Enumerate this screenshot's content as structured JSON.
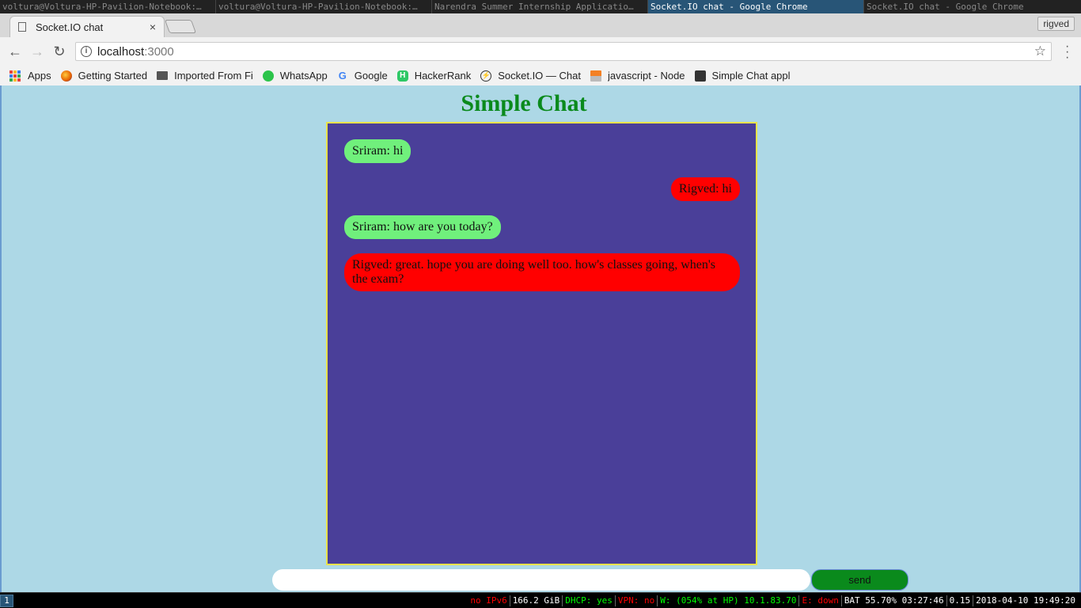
{
  "wm": {
    "windows": [
      {
        "title": "voltura@Voltura-HP-Pavilion-Notebook:…",
        "focused": false
      },
      {
        "title": "voltura@Voltura-HP-Pavilion-Notebook:…",
        "focused": false
      },
      {
        "title": "Narendra Summer Internship Applicatio…",
        "focused": false
      },
      {
        "title": "Socket.IO chat - Google Chrome",
        "focused": true
      },
      {
        "title": "Socket.IO chat - Google Chrome",
        "focused": false
      }
    ],
    "workspace": "1"
  },
  "browser": {
    "tab_title": "Socket.IO chat",
    "tab_close": "×",
    "profile_name": "rigved",
    "address_host": "localhost",
    "address_port": ":3000",
    "bookmarks": [
      {
        "label": "Apps",
        "icon": "apps-grid-icon"
      },
      {
        "label": "Getting Started",
        "icon": "firefox-icon"
      },
      {
        "label": "Imported From Fi",
        "icon": "folder-icon"
      },
      {
        "label": "WhatsApp",
        "icon": "whatsapp-icon"
      },
      {
        "label": "Google",
        "icon": "google-icon"
      },
      {
        "label": "HackerRank",
        "icon": "hackerrank-icon"
      },
      {
        "label": "Socket.IO — Chat",
        "icon": "socketio-icon"
      },
      {
        "label": "javascript - Node",
        "icon": "stackoverflow-icon"
      },
      {
        "label": "Simple Chat appl",
        "icon": "page-icon"
      }
    ]
  },
  "app": {
    "title": "Simple Chat",
    "messages": [
      {
        "text": "Sriram: hi",
        "side": "left"
      },
      {
        "text": "Rigved: hi",
        "side": "right"
      },
      {
        "text": "Sriram: how are you today?",
        "side": "left"
      },
      {
        "text": "Rigved: great. hope you are doing well too. how's classes going, when's the exam?",
        "side": "right"
      }
    ],
    "input_value": "",
    "send_label": "send",
    "colors": {
      "background": "#add8e6",
      "chat_box": "#4a3f99",
      "left_bubble": "#70f07c",
      "right_bubble": "#ff0000",
      "title": "#0a8a1c",
      "send_button": "#0a8a1c"
    }
  },
  "status": {
    "items": [
      {
        "text": "no IPv6",
        "color": "#ff0000"
      },
      {
        "text": "166.2 GiB",
        "color": "#ffffff"
      },
      {
        "text": "DHCP: yes",
        "color": "#00ff00"
      },
      {
        "text": "VPN: no",
        "color": "#ff0000"
      },
      {
        "text": "W: (054% at HP) 10.1.83.70",
        "color": "#00ff00"
      },
      {
        "text": "E: down",
        "color": "#ff0000"
      },
      {
        "text": "BAT 55.70% 03:27:46",
        "color": "#ffffff"
      },
      {
        "text": "0.15",
        "color": "#ffffff"
      },
      {
        "text": "2018-04-10 19:49:20",
        "color": "#ffffff"
      }
    ]
  }
}
